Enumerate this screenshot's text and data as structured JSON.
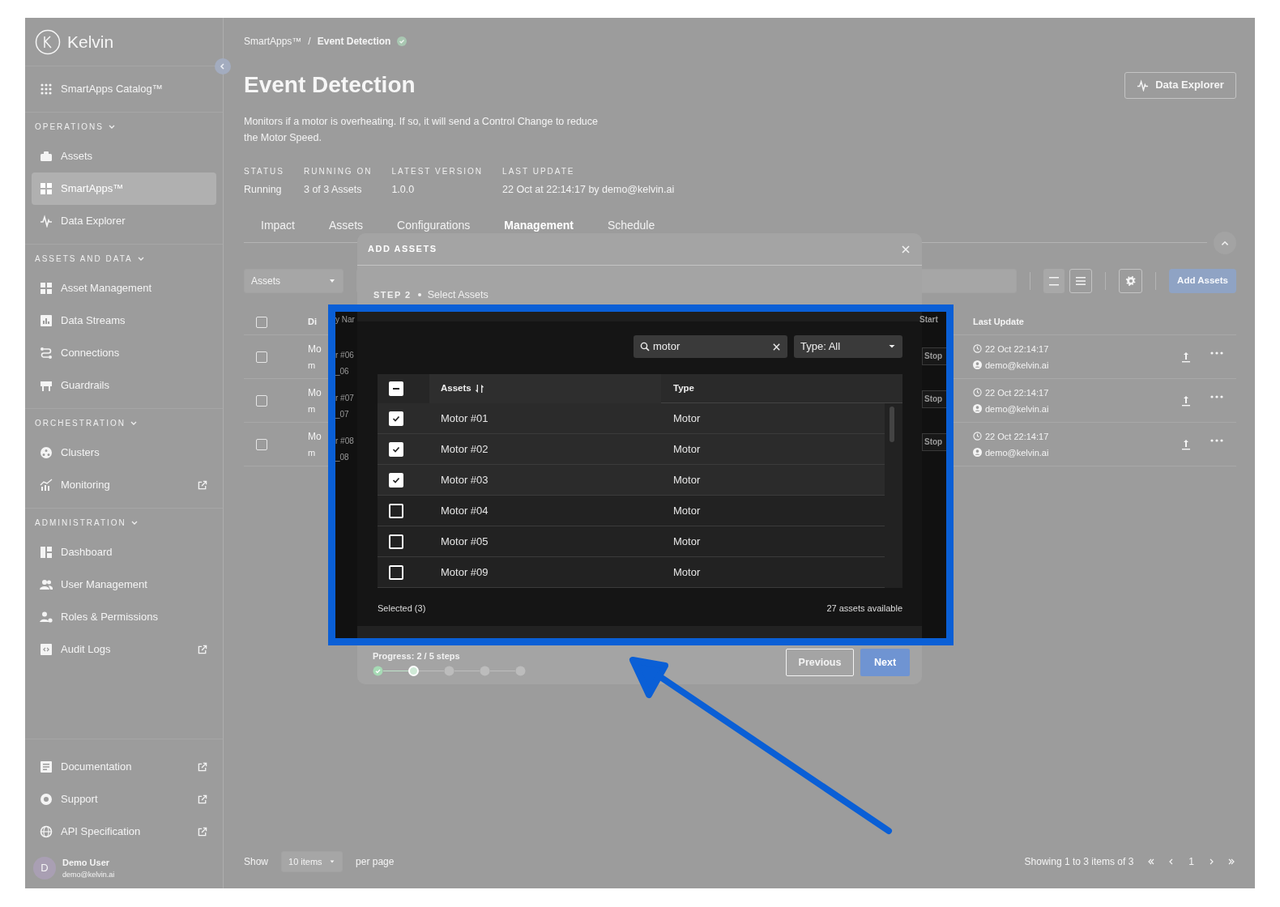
{
  "sidebar": {
    "logo": "Kelvin",
    "catalog": {
      "label": "SmartApps Catalog™",
      "selected": false
    },
    "sections": [
      {
        "title": "OPERATIONS",
        "items": [
          {
            "label": "Assets",
            "selected": false,
            "external": false
          },
          {
            "label": "SmartApps™",
            "selected": true,
            "external": false
          },
          {
            "label": "Data Explorer",
            "selected": false,
            "external": false
          }
        ]
      },
      {
        "title": "ASSETS AND DATA",
        "items": [
          {
            "label": "Asset Management",
            "selected": false,
            "external": false
          },
          {
            "label": "Data Streams",
            "selected": false,
            "external": false
          },
          {
            "label": "Connections",
            "selected": false,
            "external": false
          },
          {
            "label": "Guardrails",
            "selected": false,
            "external": false
          }
        ]
      },
      {
        "title": "ORCHESTRATION",
        "items": [
          {
            "label": "Clusters",
            "selected": false,
            "external": false
          },
          {
            "label": "Monitoring",
            "selected": false,
            "external": true
          }
        ]
      },
      {
        "title": "ADMINISTRATION",
        "items": [
          {
            "label": "Dashboard",
            "selected": false,
            "external": false
          },
          {
            "label": "User Management",
            "selected": false,
            "external": false
          },
          {
            "label": "Roles & Permissions",
            "selected": false,
            "external": false
          },
          {
            "label": "Audit Logs",
            "selected": false,
            "external": true
          }
        ]
      }
    ],
    "bottom_items": [
      {
        "label": "Documentation",
        "external": true
      },
      {
        "label": "Support",
        "external": true
      },
      {
        "label": "API Specification",
        "external": true
      }
    ],
    "user": {
      "initial": "D",
      "name": "Demo User",
      "email": "demo@kelvin.ai"
    }
  },
  "breadcrumb": {
    "parent": "SmartApps™",
    "separator": "/",
    "current": "Event Detection"
  },
  "page": {
    "title": "Event Detection",
    "description": "Monitors if a motor is overheating. If so, it will send a Control Change to reduce the Motor Speed.",
    "action_button": "Data Explorer"
  },
  "stats": [
    {
      "label": "STATUS",
      "value": "Running"
    },
    {
      "label": "RUNNING ON",
      "value": "3 of 3 Assets"
    },
    {
      "label": "LATEST VERSION",
      "value": "1.0.0"
    },
    {
      "label": "LAST UPDATE",
      "value": "22 Oct at 22:14:17 by demo@kelvin.ai"
    }
  ],
  "tabs": [
    {
      "label": "Impact",
      "selected": false
    },
    {
      "label": "Assets",
      "selected": false
    },
    {
      "label": "Configurations",
      "selected": false
    },
    {
      "label": "Management",
      "selected": true
    },
    {
      "label": "Schedule",
      "selected": false
    }
  ],
  "toolbar": {
    "filter": "Assets",
    "add_button": "Add Assets"
  },
  "asset_table": {
    "header_checked": false,
    "column_1_fragment": "Di",
    "last_update_header": "Last Update",
    "rows": [
      {
        "checked": false,
        "name_fragment": "Mo",
        "id_fragment": "m",
        "time": "22 Oct 22:14:17",
        "user": "demo@kelvin.ai"
      },
      {
        "checked": false,
        "name_fragment": "Mo",
        "id_fragment": "m",
        "time": "22 Oct 22:14:17",
        "user": "demo@kelvin.ai"
      },
      {
        "checked": false,
        "name_fragment": "Mo",
        "id_fragment": "m",
        "time": "22 Oct 22:14:17",
        "user": "demo@kelvin.ai"
      }
    ]
  },
  "footer": {
    "show": "Show",
    "page_size": "10 items",
    "per_page": "per page",
    "summary": "Showing 1 to 3 items of 3",
    "page": "1"
  },
  "modal": {
    "title": "ADD ASSETS",
    "step_label": "STEP 2",
    "step_name": "Select Assets",
    "progress": "Progress: 2 / 5 steps",
    "steps": [
      {
        "completed": true,
        "current": false
      },
      {
        "completed": false,
        "current": true
      },
      {
        "completed": false,
        "current": false
      },
      {
        "completed": false,
        "current": false
      },
      {
        "completed": false,
        "current": false
      }
    ],
    "previous": "Previous",
    "next": "Next"
  },
  "highlight": {
    "left_column": {
      "header": "y Nar",
      "rows": [
        {
          "name": "r #06",
          "id": "_06"
        },
        {
          "name": "r #07",
          "id": "_07"
        },
        {
          "name": "r #08",
          "id": "_08"
        }
      ]
    },
    "right_column": {
      "header": "Start",
      "rows": [
        "Stop",
        "Stop",
        "Stop"
      ]
    },
    "search": {
      "value": "motor"
    },
    "type_filter": "Type: All",
    "header_indeterminate": true,
    "columns": [
      "Assets",
      "Type"
    ],
    "rows": [
      {
        "name": "Motor #01",
        "type": "Motor",
        "checked": true
      },
      {
        "name": "Motor #02",
        "type": "Motor",
        "checked": true
      },
      {
        "name": "Motor #03",
        "type": "Motor",
        "checked": true
      },
      {
        "name": "Motor #04",
        "type": "Motor",
        "checked": false
      },
      {
        "name": "Motor #05",
        "type": "Motor",
        "checked": false
      },
      {
        "name": "Motor #09",
        "type": "Motor",
        "checked": false
      }
    ],
    "selected_count": "Selected (3)",
    "available": "27 assets available"
  }
}
